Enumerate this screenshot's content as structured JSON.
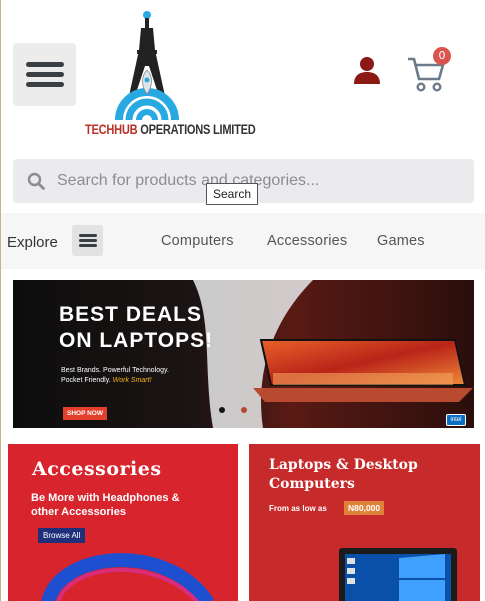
{
  "header": {
    "menu_icon": "hamburger-icon",
    "logo": {
      "name_part1": "TECHHUB",
      "name_part2": " OPERATIONS LIMITED"
    },
    "user_icon": "user-icon",
    "cart": {
      "icon": "cart-icon",
      "count": "0"
    }
  },
  "search": {
    "placeholder": "Search for products and categories...",
    "tooltip": "Search"
  },
  "nav": {
    "explore_label": "Explore",
    "links": [
      "Computers",
      "Accessories",
      "Games"
    ]
  },
  "hero": {
    "title_line1": "BEST DEALS",
    "title_line2": "ON LAPTOPS!",
    "sub_line1": "Best Brands. Powerful Technology.",
    "sub_line2": "Pocket Friendly.",
    "sub_highlight": "Work Smart!",
    "cta": "SHOP NOW",
    "badge": "intel"
  },
  "tiles": {
    "accessories": {
      "title": "Accessories",
      "line1": "Be More with Headphones &",
      "line2": "other Accessories",
      "cta": "Browse All"
    },
    "laptops": {
      "title_line1": "Laptops & Desktop",
      "title_line2": "Computers",
      "from": "From as low as",
      "price": "N80,000"
    }
  },
  "colors": {
    "badge_red": "#d9534f",
    "brand_red": "#b8312a",
    "tile_red": "#d8242d",
    "logo_blue": "#29a9e1"
  }
}
